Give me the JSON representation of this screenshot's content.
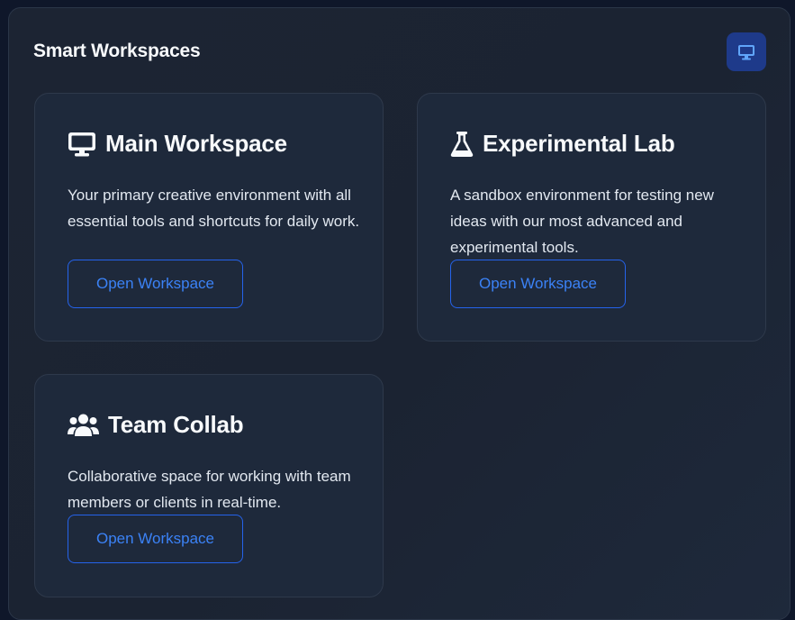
{
  "header": {
    "title": "Smart Workspaces",
    "action_icon": "desktop-icon"
  },
  "colors": {
    "accent": "#2563eb",
    "accent_text": "#3b82f6",
    "card_bg": "#1e293b",
    "panel_bg": "#1b2332",
    "icon_button_bg": "#1e3a8a"
  },
  "workspaces": [
    {
      "icon": "desktop-icon",
      "title": "Main Workspace",
      "description": "Your primary creative environment with all essential tools and shortcuts for daily work.",
      "button_label": "Open Workspace"
    },
    {
      "icon": "flask-icon",
      "title": "Experimental Lab",
      "description": "A sandbox environment for testing new ideas with our most advanced and experimental tools.",
      "button_label": "Open Workspace"
    },
    {
      "icon": "users-icon",
      "title": "Team Collab",
      "description": "Collaborative space for working with team members or clients in real-time.",
      "button_label": "Open Workspace"
    }
  ]
}
